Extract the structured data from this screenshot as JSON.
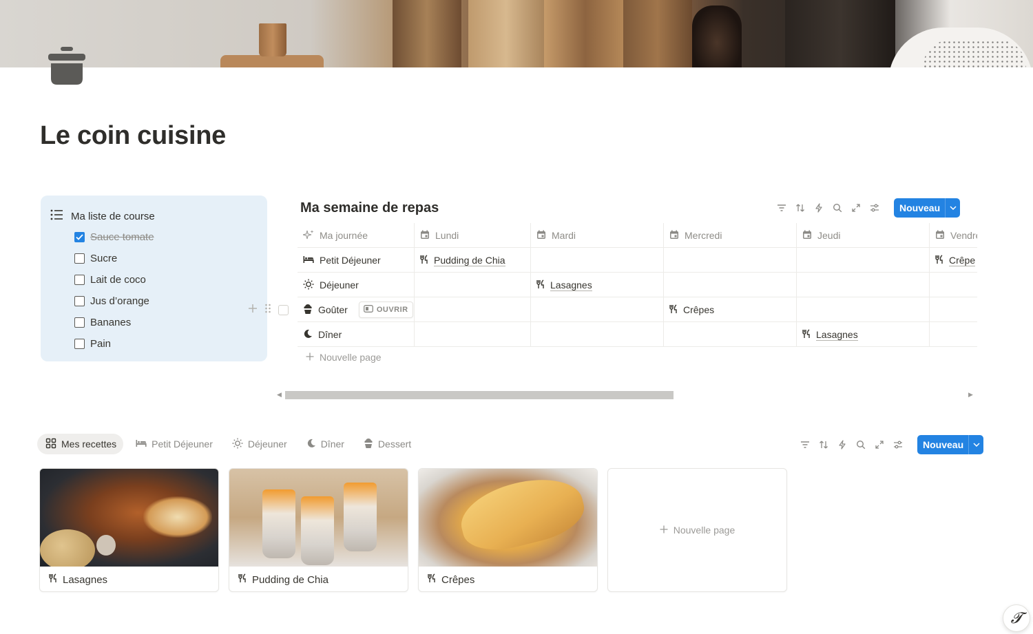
{
  "page": {
    "title": "Le coin cuisine",
    "icon": "cooking-pot-icon"
  },
  "shopping_list": {
    "title": "Ma liste de course",
    "items": [
      {
        "label": "Sauce tomate",
        "checked": true
      },
      {
        "label": "Sucre",
        "checked": false
      },
      {
        "label": "Lait de coco",
        "checked": false
      },
      {
        "label": "Jus d’orange",
        "checked": false
      },
      {
        "label": "Bananes",
        "checked": false
      },
      {
        "label": "Pain",
        "checked": false
      }
    ]
  },
  "meal_db": {
    "title": "Ma semaine de repas",
    "new_label": "Nouveau",
    "columns": [
      "Ma journée",
      "Lundi",
      "Mardi",
      "Mercredi",
      "Jeudi",
      "Vendre"
    ],
    "rows": [
      {
        "label": "Petit Déjeuner",
        "icon": "bed-icon",
        "cells": [
          "Pudding de Chia",
          "",
          "",
          "",
          "Crêpe"
        ]
      },
      {
        "label": "Déjeuner",
        "icon": "sun-icon",
        "cells": [
          "",
          "Lasagnes",
          "",
          "",
          ""
        ]
      },
      {
        "label": "Goûter",
        "icon": "cupcake-icon",
        "cells": [
          "",
          "",
          "Crêpes",
          "",
          ""
        ]
      },
      {
        "label": "Dîner",
        "icon": "moon-icon",
        "cells": [
          "",
          "",
          "",
          "Lasagnes",
          ""
        ]
      }
    ],
    "open_label": "OUVRIR",
    "new_page_label": "Nouvelle page"
  },
  "recipes": {
    "tabs": [
      {
        "label": "Mes recettes",
        "icon": "gallery-icon",
        "active": true
      },
      {
        "label": "Petit Déjeuner",
        "icon": "bed-icon",
        "active": false
      },
      {
        "label": "Déjeuner",
        "icon": "sun-icon",
        "active": false
      },
      {
        "label": "Dîner",
        "icon": "moon-icon",
        "active": false
      },
      {
        "label": "Dessert",
        "icon": "cupcake-icon",
        "active": false
      }
    ],
    "new_label": "Nouveau",
    "cards": [
      {
        "title": "Lasagnes",
        "image": "lasagne"
      },
      {
        "title": "Pudding de Chia",
        "image": "chia"
      },
      {
        "title": "Crêpes",
        "image": "crepe"
      }
    ],
    "new_page_label": "Nouvelle page"
  },
  "colors": {
    "accent": "#2383e2",
    "callout_bg": "#e6f0f8",
    "text": "#37352f",
    "muted": "#9b9a97"
  }
}
